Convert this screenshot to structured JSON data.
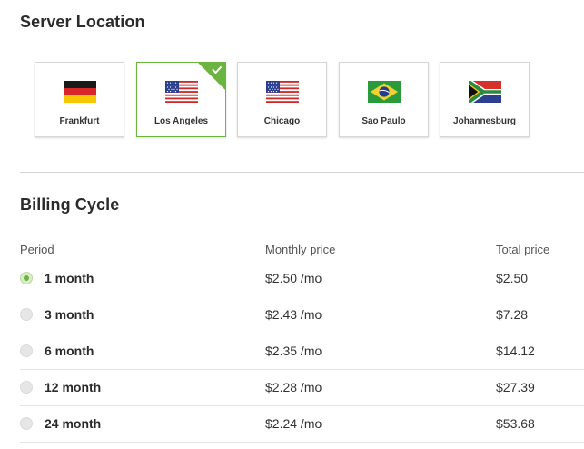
{
  "server_location": {
    "title": "Server Location",
    "locations": [
      {
        "label": "Frankfurt",
        "flag": "germany-flag-icon",
        "selected": false
      },
      {
        "label": "Los Angeles",
        "flag": "usa-flag-icon",
        "selected": true
      },
      {
        "label": "Chicago",
        "flag": "usa-flag-icon",
        "selected": false
      },
      {
        "label": "Sao Paulo",
        "flag": "brazil-flag-icon",
        "selected": false
      },
      {
        "label": "Johannesburg",
        "flag": "south-africa-flag-icon",
        "selected": false
      }
    ]
  },
  "billing_cycle": {
    "title": "Billing Cycle",
    "headers": {
      "period": "Period",
      "monthly": "Monthly price",
      "total": "Total price"
    },
    "rows": [
      {
        "period": "1 month",
        "monthly": "$2.50 /mo",
        "total": "$2.50",
        "selected": true
      },
      {
        "period": "3 month",
        "monthly": "$2.43 /mo",
        "total": "$7.28",
        "selected": false
      },
      {
        "period": "6 month",
        "monthly": "$2.35 /mo",
        "total": "$14.12",
        "selected": false
      },
      {
        "period": "12 month",
        "monthly": "$2.28 /mo",
        "total": "$27.39",
        "selected": false
      },
      {
        "period": "24 month",
        "monthly": "$2.24 /mo",
        "total": "$53.68",
        "selected": false
      }
    ]
  },
  "colors": {
    "accent": "#6db33f",
    "divider": "#d4d4d4"
  }
}
